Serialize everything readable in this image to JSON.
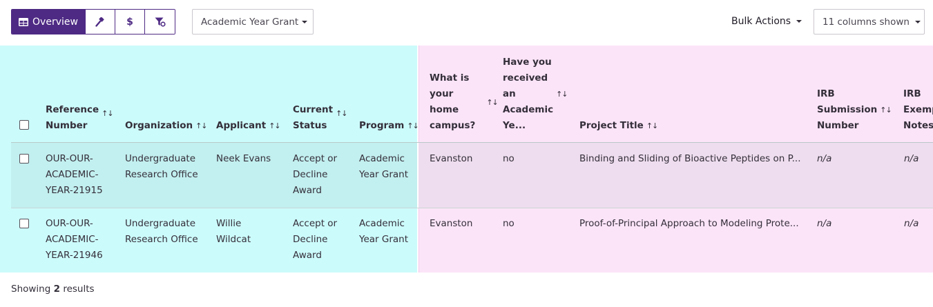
{
  "toolbar": {
    "views": [
      {
        "label": "Overview",
        "icon": "table-grid-icon",
        "active": true
      },
      {
        "label": "",
        "icon": "gavel-icon",
        "active": false
      },
      {
        "label": "",
        "icon": "dollar-icon",
        "active": false
      },
      {
        "label": "",
        "icon": "filter-icon",
        "active": false
      }
    ],
    "program_select": "Academic Year Grant",
    "bulk_actions": "Bulk Actions",
    "columns_shown": "11 columns shown"
  },
  "table": {
    "columns": [
      {
        "lines": [
          "Reference",
          "Number"
        ]
      },
      {
        "lines": [
          "Organization"
        ]
      },
      {
        "lines": [
          "Applicant"
        ]
      },
      {
        "lines": [
          "Current",
          "Status"
        ]
      },
      {
        "lines": [
          "Program"
        ]
      },
      {
        "lines": [
          "What is",
          "your",
          "home",
          "campus?"
        ]
      },
      {
        "lines": [
          "Have you",
          "received",
          "an",
          "Academic",
          "Ye..."
        ]
      },
      {
        "lines": [
          "Project Title"
        ]
      },
      {
        "lines": [
          "IRB",
          "Submission",
          "Number"
        ]
      },
      {
        "lines": [
          "IRB",
          "Exempt",
          "Notes"
        ]
      }
    ],
    "sort_glyph": "↑↓",
    "rows": [
      {
        "reference": [
          "OUR-OUR-",
          "ACADEMIC-",
          "YEAR-21915"
        ],
        "organization": [
          "Undergraduate",
          "Research Office"
        ],
        "applicant": [
          "Neek Evans"
        ],
        "status": [
          "Accept or",
          "Decline",
          "Award"
        ],
        "program": [
          "Academic",
          "Year Grant"
        ],
        "campus": "Evanston",
        "received": "no",
        "project_title": "Binding and Sliding of Bioactive Peptides on P...",
        "irb_number": "n/a",
        "irb_notes": "n/a"
      },
      {
        "reference": [
          "OUR-OUR-",
          "ACADEMIC-",
          "YEAR-21946"
        ],
        "organization": [
          "Undergraduate",
          "Research Office"
        ],
        "applicant": [
          "Willie",
          "Wildcat"
        ],
        "status": [
          "Accept or",
          "Decline",
          "Award"
        ],
        "program": [
          "Academic",
          "Year Grant"
        ],
        "campus": "Evanston",
        "received": "no",
        "project_title": "Proof-of-Principal Approach to Modeling Prote...",
        "irb_number": "n/a",
        "irb_notes": "n/a"
      }
    ]
  },
  "footer": {
    "prefix": "Showing",
    "count": "2",
    "suffix": "results"
  },
  "colors": {
    "brand_purple": "#4e2a84",
    "cyan_zone": "#ccfbfb",
    "pink_zone": "#fce4f8"
  }
}
